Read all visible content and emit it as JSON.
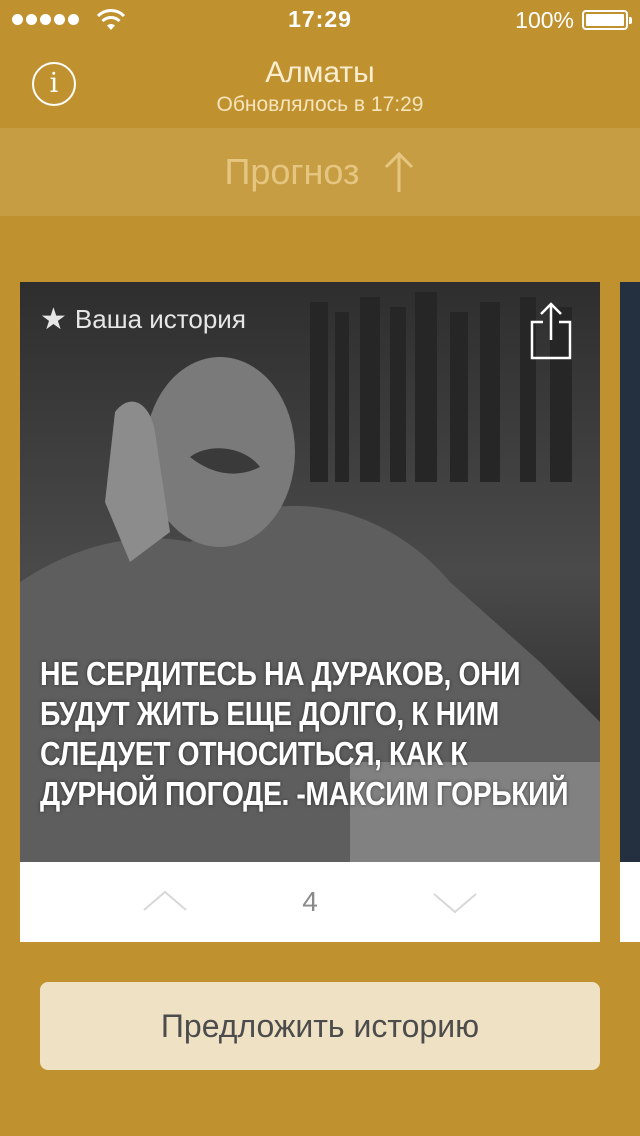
{
  "status_bar": {
    "time": "17:29",
    "battery": "100%",
    "battery_level": 1.0,
    "signal_bars": 5
  },
  "header": {
    "info_icon": "info-icon",
    "city": "Алматы",
    "updated": "Обновлялось в 17:29"
  },
  "forecast": {
    "label": "Прогноз",
    "icon": "arrow-up-icon"
  },
  "card": {
    "favorite_label": "Ваша история",
    "favorite_icon": "star-icon",
    "share_icon": "share-icon",
    "quote": "НЕ СЕРДИТЕСЬ НА ДУРАКОВ, ОНИ БУДУТ ЖИТЬ ЕЩЕ ДОЛГО, К НИМ СЛЕДУЕТ ОТНОСИТЬСЯ, КАК К ДУРНОЙ ПОГОДЕ. -МАКСИМ ГОРЬКИЙ",
    "page_number": "4",
    "prev_icon": "chevron-up-icon",
    "next_icon": "chevron-down-icon"
  },
  "actions": {
    "suggest_label": "Предложить историю"
  },
  "colors": {
    "background": "#c0922f",
    "forecast_strip": "#c79d44",
    "button_bg": "#efe1c4"
  }
}
